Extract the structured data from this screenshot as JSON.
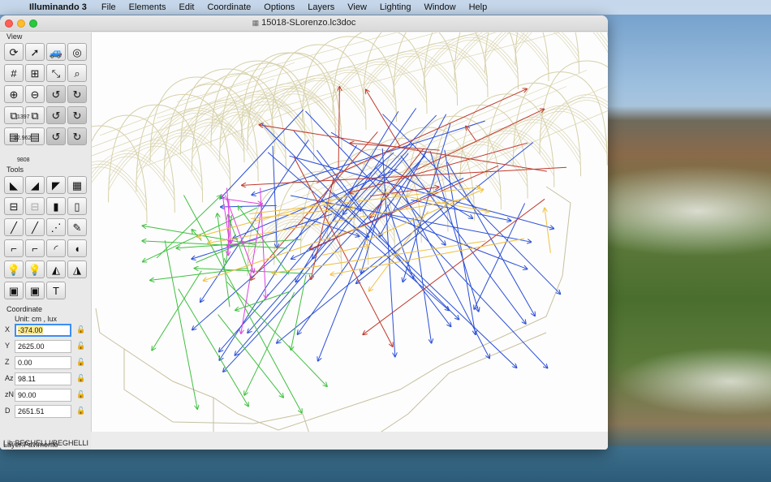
{
  "menubar": {
    "apple": "",
    "app_name": "Illuminando 3",
    "items": [
      "File",
      "Elements",
      "Edit",
      "Coordinate",
      "Options",
      "Layers",
      "View",
      "Lighting",
      "Window",
      "Help"
    ]
  },
  "window": {
    "title": "15018-SLorenzo.lc3doc",
    "doc_icon": "lc3doc-file-icon"
  },
  "palette": {
    "view_label": "View",
    "tools_label": "Tools",
    "coordinate_label": "Coordinate",
    "zoom_value": "1397",
    "scale_value": "32.962",
    "camera_value": "9808",
    "unit_label": "Unit:  cm ,  lux",
    "coords": [
      {
        "label": "X",
        "value": "-374.00"
      },
      {
        "label": "Y",
        "value": "2625.00"
      },
      {
        "label": "Z",
        "value": "0.00"
      },
      {
        "label": "Az",
        "value": "98.11"
      },
      {
        "label": "zN",
        "value": "90.00"
      },
      {
        "label": "D",
        "value": "2651.51"
      }
    ],
    "layer_status": "Layer:Pavimento",
    "lib_status": "Lib:BEGHELLI/BEGHELLI"
  },
  "view_tools": [
    {
      "name": "rotate-view-icon",
      "glyph": "⟳"
    },
    {
      "name": "pointer-esc-icon",
      "glyph": "➚"
    },
    {
      "name": "car-icon",
      "glyph": "🚙"
    },
    {
      "name": "target-icon",
      "glyph": "◎"
    },
    {
      "name": "grid-icon",
      "glyph": "#"
    },
    {
      "name": "grid-bold-icon",
      "glyph": "⊞"
    },
    {
      "name": "axes-icon",
      "glyph": "⤡"
    },
    {
      "name": "search-3d-icon",
      "glyph": "⌕"
    },
    {
      "name": "zoom-in-icon",
      "glyph": "⊕"
    },
    {
      "name": "zoom-out-icon",
      "glyph": "⊖"
    },
    {
      "name": "rotate-x-left-icon",
      "glyph": "↺"
    },
    {
      "name": "rotate-x-right-icon",
      "glyph": "↻"
    },
    {
      "name": "scale-down-icon",
      "glyph": "⧉"
    },
    {
      "name": "scale-up-icon",
      "glyph": "⧉"
    },
    {
      "name": "rotate-y-left-icon",
      "glyph": "↺"
    },
    {
      "name": "rotate-y-right-icon",
      "glyph": "↻"
    },
    {
      "name": "camera-back-icon",
      "glyph": "▤"
    },
    {
      "name": "camera-forward-icon",
      "glyph": "▤"
    },
    {
      "name": "rotate-z-left-icon",
      "glyph": "↺"
    },
    {
      "name": "rotate-z-right-icon",
      "glyph": "↻"
    }
  ],
  "tools": [
    {
      "name": "insert-luminaire-icon",
      "glyph": "◣"
    },
    {
      "name": "insert-luminaire-b-icon",
      "glyph": "◢"
    },
    {
      "name": "luminaire-group-icon",
      "glyph": "◤"
    },
    {
      "name": "wall-icon",
      "glyph": "▦"
    },
    {
      "name": "window-icon",
      "glyph": "⊟"
    },
    {
      "name": "window-b-icon",
      "glyph": "⊟"
    },
    {
      "name": "window-c-icon",
      "glyph": "▮"
    },
    {
      "name": "window-d-icon",
      "glyph": "▯"
    },
    {
      "name": "line-icon",
      "glyph": "╱"
    },
    {
      "name": "line-b-icon",
      "glyph": "╱"
    },
    {
      "name": "line-points-icon",
      "glyph": "⋰"
    },
    {
      "name": "pencil-icon",
      "glyph": "✎"
    },
    {
      "name": "polyline-icon",
      "glyph": "⌐"
    },
    {
      "name": "polyline-b-icon",
      "glyph": "⌐"
    },
    {
      "name": "arc-icon",
      "glyph": "◜"
    },
    {
      "name": "curve-fill-icon",
      "glyph": "◖"
    },
    {
      "name": "bulb-icon",
      "glyph": "💡"
    },
    {
      "name": "bulb-b-icon",
      "glyph": "💡"
    },
    {
      "name": "spot-icon",
      "glyph": "◭"
    },
    {
      "name": "spot-b-icon",
      "glyph": "◮"
    },
    {
      "name": "camera-icon",
      "glyph": "▣"
    },
    {
      "name": "camera-b-icon",
      "glyph": "▣"
    },
    {
      "name": "text-tool-icon",
      "glyph": "T"
    }
  ],
  "colors": {
    "mesh": "#d6d0a8",
    "outline": "#c8c0a0",
    "blue": "#2a4fd8",
    "red": "#c0392b",
    "green": "#3fbf3f",
    "magenta": "#e040e0",
    "yellow": "#f0c040"
  }
}
